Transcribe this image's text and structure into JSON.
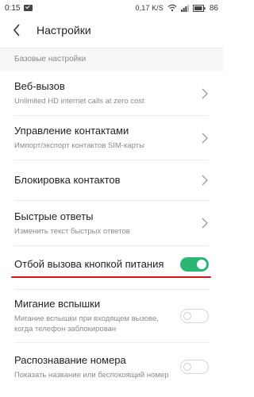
{
  "status_bar": {
    "time": "0:15",
    "net_rate": "0,17 K/S",
    "battery": "86"
  },
  "header": {
    "title": "Настройки"
  },
  "section": {
    "title": "Базовые настройки"
  },
  "rows": [
    {
      "title": "Веб-вызов",
      "subtitle": "Unlimited HD internet calls at zero cost"
    },
    {
      "title": "Управление контактами",
      "subtitle": "Импорт/экспорт контактов SIM-карты"
    },
    {
      "title": "Блокировка контактов"
    },
    {
      "title": "Быстрые ответы",
      "subtitle": "Изменить текст быстрых ответов"
    },
    {
      "title": "Отбой вызова кнопкой питания",
      "toggle": "on"
    },
    {
      "title": "Мигание вспышки",
      "subtitle": "Мигание вспышки при входящем вызове, когда телефон заблокирован",
      "toggle": "off"
    },
    {
      "title": "Распознавание номера",
      "subtitle": "Показать название или беспокоящий номер",
      "toggle": "off"
    }
  ],
  "colors": {
    "toggle_on": "#2bb673",
    "highlight_underline": "#d0161b"
  }
}
